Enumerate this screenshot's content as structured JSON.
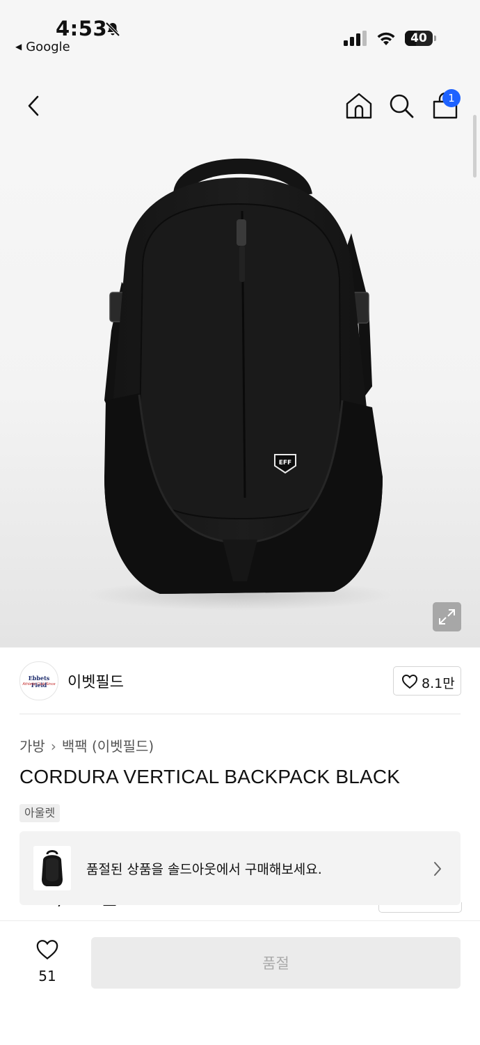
{
  "status_bar": {
    "time": "4:53",
    "back_app": "Google",
    "battery": "40",
    "battery_level_percent": 40,
    "icons": [
      "bell-slash-icon",
      "signal-icon",
      "wifi-icon",
      "battery-icon"
    ]
  },
  "nav": {
    "cart_count": "1",
    "icons": [
      "back-icon",
      "home-icon",
      "search-icon",
      "shopping-bag-icon"
    ],
    "accent_color": "#1e62ff"
  },
  "product_image": {
    "logo_badge": "EFF",
    "expand_icon": "expand-icon"
  },
  "brand": {
    "name": "이벳필드",
    "logo_text": "Ebbets Field",
    "logo_subtext": "Athletic Club Since",
    "likes": "8.1만"
  },
  "breadcrumb": {
    "category": "가방",
    "subcategory": "백팩 (이벳필드)"
  },
  "product": {
    "title": "CORDURA VERTICAL BACKPACK BLACK",
    "tag": "아울렛",
    "price_partial": "129,000원"
  },
  "soldout_banner": {
    "text": "품절된 상품을 솔드아웃에서 구매해보세요."
  },
  "bottom_bar": {
    "wish_count": "51",
    "buy_label": "품절"
  }
}
